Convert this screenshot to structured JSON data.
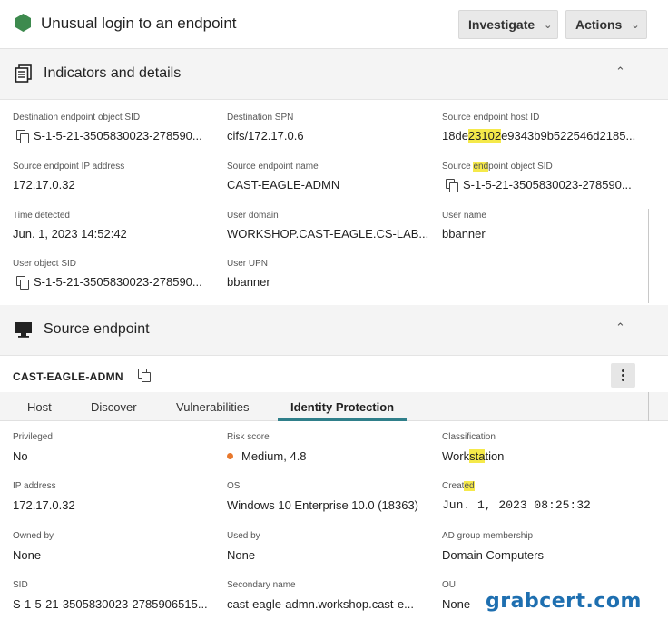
{
  "header": {
    "title": "Unusual login to an endpoint",
    "investigate_label": "Investigate",
    "actions_label": "Actions"
  },
  "indicators": {
    "title": "Indicators and details",
    "fields": {
      "dest_sid_label": "Destination endpoint object SID",
      "dest_sid_value": "S-1-5-21-3505830023-278590...",
      "dest_spn_label": "Destination SPN",
      "dest_spn_value": "cifs/172.17.0.6",
      "src_host_id_label": "Source endpoint host ID",
      "src_host_id_pre": "18de",
      "src_host_id_hl": "23102",
      "src_host_id_post": "e9343b9b522546d2185...",
      "src_ip_label": "Source endpoint IP address",
      "src_ip_value": "172.17.0.32",
      "src_name_label": "Source endpoint name",
      "src_name_value": "CAST-EAGLE-ADMN",
      "src_sid_label_pre": "Source ",
      "src_sid_label_hl": "end",
      "src_sid_label_post": "point object SID",
      "src_sid_value": "S-1-5-21-3505830023-278590...",
      "time_label": "Time detected",
      "time_value": "Jun. 1, 2023 14:52:42",
      "domain_label": "User domain",
      "domain_value": "WORKSHOP.CAST-EAGLE.CS-LAB...",
      "username_label": "User name",
      "username_value": "bbanner",
      "user_sid_label": "User object SID",
      "user_sid_value": "S-1-5-21-3505830023-278590...",
      "upn_label": "User UPN",
      "upn_value": "bbanner"
    }
  },
  "source": {
    "title": "Source endpoint",
    "host_name": "CAST-EAGLE-ADMN",
    "tabs": [
      "Host",
      "Discover",
      "Vulnerabilities",
      "Identity Protection"
    ],
    "fields": {
      "privileged_label": "Privileged",
      "privileged_value": "No",
      "risk_label": "Risk score",
      "risk_value": "Medium, 4.8",
      "class_label": "Classification",
      "class_pre": "Work",
      "class_hl": "sta",
      "class_post": "tion",
      "ip_label": "IP address",
      "ip_value": "172.17.0.32",
      "os_label": "OS",
      "os_value": "Windows 10 Enterprise 10.0 (18363)",
      "created_pre": "Creat",
      "created_hl": "ed",
      "created_value": "Jun. 1, 2023 08:25:32",
      "owned_label": "Owned by",
      "owned_value": "None",
      "used_label": "Used by",
      "used_value": "None",
      "adgroup_label": "AD group membership",
      "adgroup_value": "Domain Computers",
      "sid_label": "SID",
      "sid_value": "S-1-5-21-3505830023-2785906515...",
      "secondary_label": "Secondary name",
      "secondary_value": "cast-eagle-admn.workshop.cast-e...",
      "ou_label": "OU",
      "ou_value": "None"
    }
  },
  "watermark": "grabcert.com",
  "colors": {
    "status_icon": "#3d8a4e",
    "risk_medium": "#e8782c",
    "tab_accent": "#2f7f8a",
    "highlight": "#f5e94a",
    "watermark": "#1e6fb0"
  }
}
